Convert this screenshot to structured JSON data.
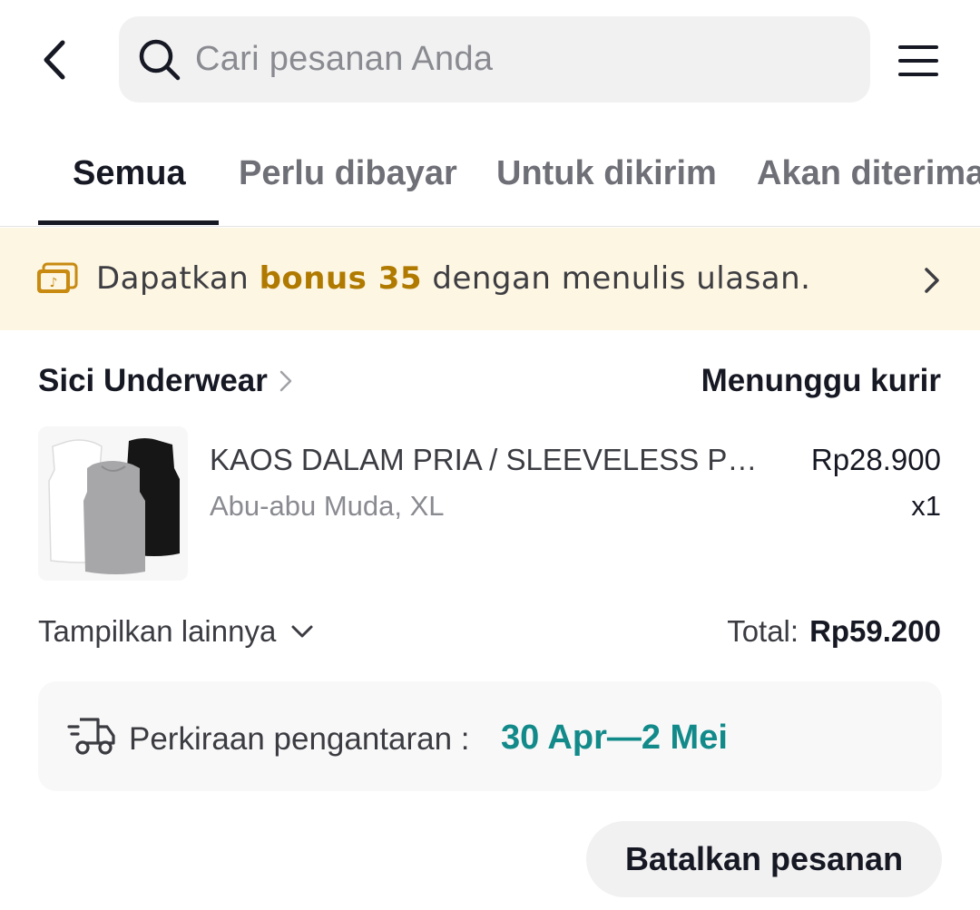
{
  "header": {
    "search_placeholder": "Cari pesanan Anda",
    "back_icon": "chevron-left-icon",
    "search_icon": "search-icon",
    "menu_icon": "hamburger-menu-icon"
  },
  "tabs": [
    {
      "label": "Semua",
      "active": true
    },
    {
      "label": "Perlu dibayar",
      "active": false
    },
    {
      "label": "Untuk dikirim",
      "active": false
    },
    {
      "label": "Akan diterima",
      "active": false
    }
  ],
  "banner": {
    "prefix": "Dapatkan",
    "highlight": "bonus 35",
    "suffix": "dengan menulis ulasan.",
    "icon": "coins-icon"
  },
  "order": {
    "shop_name": "Sici Underwear",
    "status": "Menunggu kurir",
    "product": {
      "title": "KAOS DALAM PRIA / SLEEVELESS PRIA",
      "variant": "Abu-abu Muda, XL",
      "price": "Rp28.900",
      "quantity": "x1"
    },
    "show_more_label": "Tampilkan lainnya",
    "total_label": "Total:",
    "total_value": "Rp59.200",
    "delivery": {
      "label": "Perkiraan pengantaran :",
      "date": "30 Apr—2 Mei",
      "icon": "delivery-truck-icon"
    },
    "cancel_label": "Batalkan pesanan"
  },
  "colors": {
    "accent_teal": "#138a8a",
    "banner_bg": "#fdf6e3",
    "bonus_highlight": "#b07a00",
    "text_primary": "#161823"
  }
}
